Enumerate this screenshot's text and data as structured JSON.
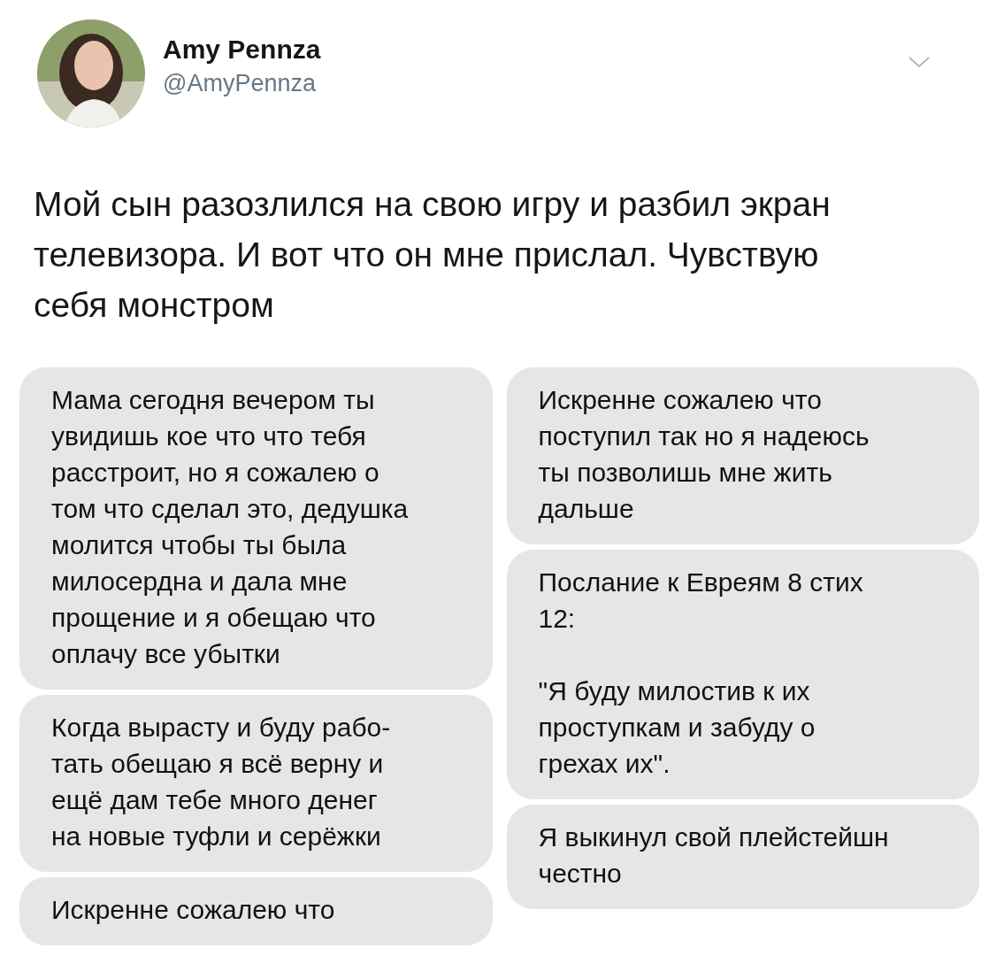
{
  "author": {
    "name": "Amy Pennza",
    "handle": "@AmyPennza"
  },
  "tweet_text": "Мой сын разозлился на свою игру и разбил экран\nтелевизора. И вот что он мне прислал. Чувствую\nсебя монстром",
  "image": {
    "columns": [
      {
        "messages": [
          "Мама сегодня вечером ты\nувидишь кое что что тебя\nрасстроит, но я сожалею о\nтом что сделал это, дедушка\nмолится чтобы ты была\nмилосердна и дала мне\nпрощение и я обещаю что\nоплачу все убытки",
          "Когда вырасту и буду рабо-\nтать обещаю я всё верну и\nещё дам тебе много денег\nна новые туфли и серёжки",
          "Искренне сожалею что"
        ]
      },
      {
        "messages": [
          "Искренне сожалею что\nпоступил так но я надеюсь\nты позволишь мне жить\nдальше",
          "Послание к Евреям 8 стих\n12:\n\n\"Я буду милостив к их\nпроступкам и забуду о\nгрехах их\".",
          "Я выкинул свой плейстейшн\nчестно"
        ]
      }
    ]
  }
}
